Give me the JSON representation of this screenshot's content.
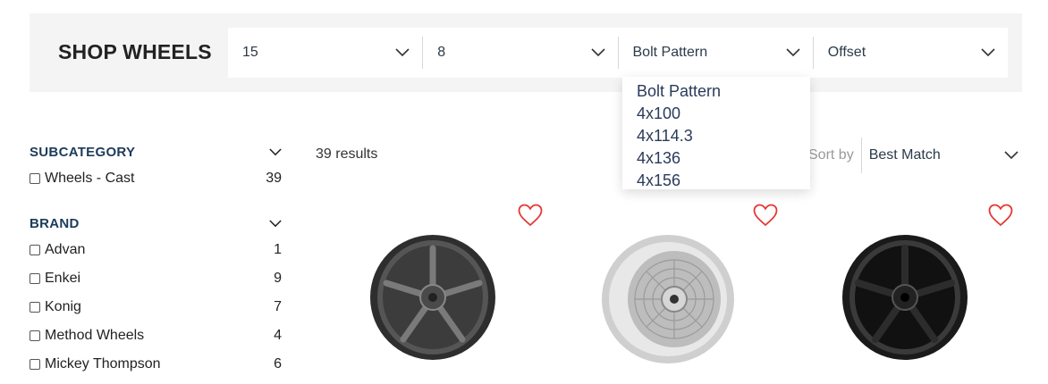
{
  "search": {
    "title": "SHOP WHEELS",
    "selects": [
      {
        "value": "15"
      },
      {
        "value": "8"
      },
      {
        "value": "Bolt Pattern"
      },
      {
        "value": "Offset"
      }
    ],
    "dropdown_options": [
      "Bolt Pattern",
      "4x100",
      "4x114.3",
      "4x136",
      "4x156"
    ]
  },
  "sidebar": {
    "facets": [
      {
        "title": "SUBCATEGORY",
        "items": [
          {
            "label": "Wheels - Cast",
            "count": "39"
          }
        ]
      },
      {
        "title": "BRAND",
        "items": [
          {
            "label": "Advan",
            "count": "1"
          },
          {
            "label": "Enkei",
            "count": "9"
          },
          {
            "label": "Konig",
            "count": "7"
          },
          {
            "label": "Method Wheels",
            "count": "4"
          },
          {
            "label": "Mickey Thompson",
            "count": "6"
          }
        ]
      }
    ]
  },
  "results": {
    "count_text": "39 results",
    "sort_label": "Sort by",
    "sort_value": "Best Match"
  },
  "products": [
    {
      "icon": "wheel-gunmetal-split-spoke"
    },
    {
      "icon": "wheel-silver-mesh"
    },
    {
      "icon": "wheel-black-split-spoke"
    }
  ],
  "colors": {
    "heart": "#e53935",
    "title": "#1c3b5a"
  }
}
